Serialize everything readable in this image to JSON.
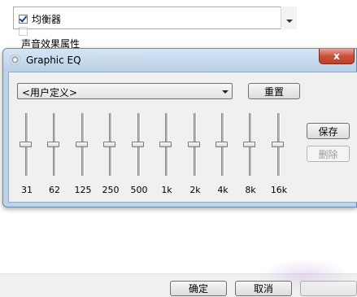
{
  "background_dialog": {
    "list_items": [
      {
        "label": "均衡器",
        "checked": true
      },
      {
        "label": "",
        "checked": false
      }
    ],
    "section_label": "声音效果属性",
    "ok_label": "确定",
    "cancel_label": "取消"
  },
  "eq_window": {
    "title": "Graphic EQ",
    "close_glyph": "x",
    "preset_value": "<用户定义>",
    "reset_label": "重置",
    "save_label": "保存",
    "delete_label": "删除",
    "delete_enabled": false,
    "bands": [
      {
        "label": "31",
        "level": 0.5
      },
      {
        "label": "62",
        "level": 0.5
      },
      {
        "label": "125",
        "level": 0.5
      },
      {
        "label": "250",
        "level": 0.5
      },
      {
        "label": "500",
        "level": 0.5
      },
      {
        "label": "1k",
        "level": 0.5
      },
      {
        "label": "2k",
        "level": 0.5
      },
      {
        "label": "4k",
        "level": 0.5
      },
      {
        "label": "8k",
        "level": 0.5
      },
      {
        "label": "16k",
        "level": 0.5
      }
    ]
  }
}
